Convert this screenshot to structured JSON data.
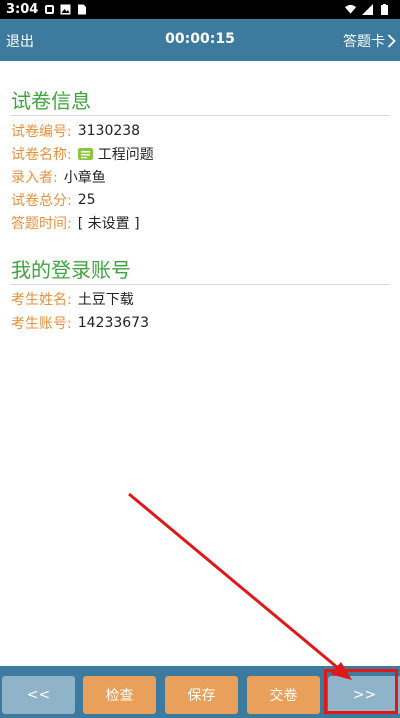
{
  "status_bar": {
    "time": "3:04"
  },
  "header": {
    "exit": "退出",
    "timer": "00:00:15",
    "answer_sheet": "答题卡"
  },
  "exam_info": {
    "title": "试卷信息",
    "rows": [
      {
        "label": "试卷编号:",
        "value": "3130238"
      },
      {
        "label": "试卷名称:",
        "value": "工程问题"
      },
      {
        "label": "录入者:",
        "value": "小章鱼"
      },
      {
        "label": "试卷总分:",
        "value": "25"
      },
      {
        "label": "答题时间:",
        "value": "[ 未设置 ]"
      }
    ]
  },
  "account": {
    "title": "我的登录账号",
    "rows": [
      {
        "label": "考生姓名:",
        "value": "土豆下载"
      },
      {
        "label": "考生账号:",
        "value": "14233673"
      }
    ]
  },
  "bottom_bar": {
    "prev": "<<",
    "check": "检查",
    "save": "保存",
    "submit": "交卷",
    "next": ">>"
  },
  "colors": {
    "accent": "#3d7b9e",
    "section_title": "#3fa53f",
    "label": "#e8913c",
    "action_button": "#e8a05a",
    "nav_button": "#8fb3c8",
    "annotation": "#e01818"
  }
}
